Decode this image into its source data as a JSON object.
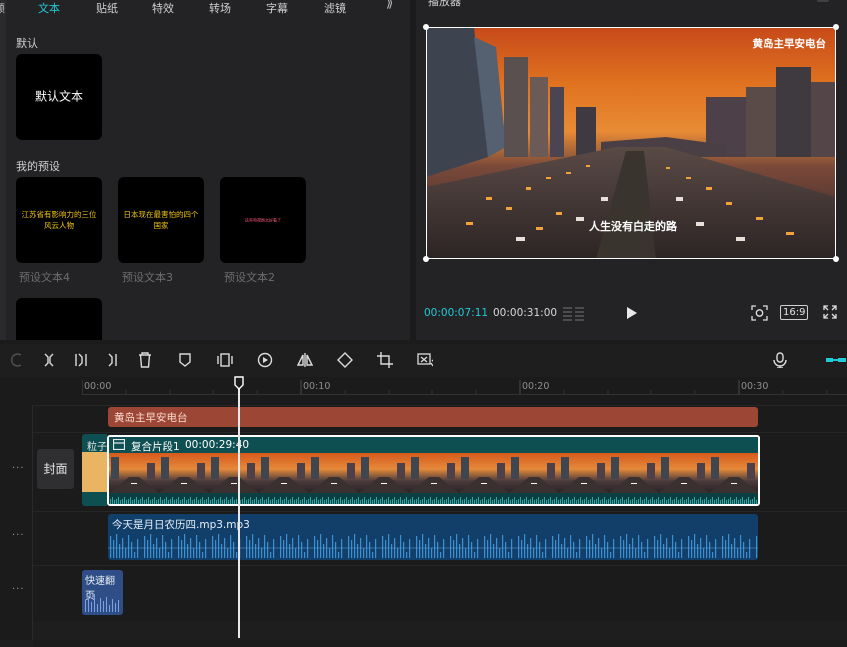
{
  "library": {
    "tabs": [
      {
        "label": "颜",
        "active": false
      },
      {
        "label": "文本",
        "active": true
      },
      {
        "label": "贴纸",
        "active": false
      },
      {
        "label": "特效",
        "active": false
      },
      {
        "label": "转场",
        "active": false
      },
      {
        "label": "字幕",
        "active": false
      },
      {
        "label": "滤镜",
        "active": false
      }
    ],
    "default_section": "默认",
    "default_card": "默认文本",
    "preset_section": "我的预设",
    "presets": [
      {
        "text": "江苏省有影响力的三位风云人物",
        "caption": "预设文本4"
      },
      {
        "text": "日本现在最害怕的四个国家",
        "caption": "预设文本3"
      },
      {
        "text": "这些电视剧太好看了",
        "caption": "预设文本2"
      }
    ]
  },
  "player": {
    "title": "播放器",
    "video_top_text": "黄岛主早安电台",
    "video_subtitle": "人生没有白走的路",
    "current_time": "00:00:07:11",
    "total_time": "00:00:31:00",
    "ratio": "16:9"
  },
  "toolbar": {
    "tools": [
      "split-icon",
      "split-left-icon",
      "split-right-icon",
      "delete-icon",
      "marker-icon",
      "freeze-icon",
      "reverse-icon",
      "mirror-icon",
      "rotate-icon",
      "crop-icon",
      "smart-cut-icon"
    ]
  },
  "timeline": {
    "ticks": [
      "00:00",
      "00:10",
      "00:20",
      "00:30"
    ],
    "cover_label": "封面",
    "more": "···",
    "title_clip": "黄岛主早安电台",
    "left_clip": "粒子",
    "main_clip_name": "复合片段1",
    "main_clip_duration": "00:00:29:40",
    "audio_clip": "今天是月日农历四.mp3.mp3",
    "sfx_clip": "快速翻页"
  },
  "colors": {
    "accent": "#22c9d6",
    "title_clip": "#9c4736",
    "main_clip": "#0e4f51",
    "audio_clip": "#123f6a",
    "sfx_clip": "#2f4d86"
  }
}
